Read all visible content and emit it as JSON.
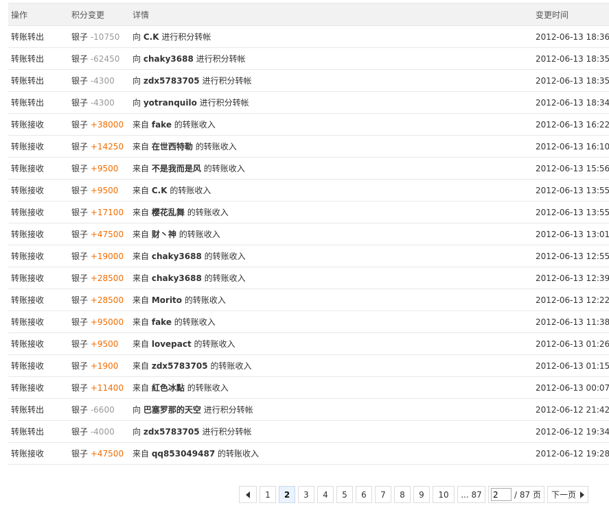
{
  "headers": {
    "action": "操作",
    "change": "积分变更",
    "detail": "详情",
    "time": "变更时间"
  },
  "rows": [
    {
      "action": "转账转出",
      "cur": "银子",
      "amount": "-10750",
      "sign": "neg",
      "pre": "向",
      "user": "C.K",
      "post": "进行积分转帐",
      "time": "2012-06-13 18:36"
    },
    {
      "action": "转账转出",
      "cur": "银子",
      "amount": "-62450",
      "sign": "neg",
      "pre": "向",
      "user": "chaky3688",
      "post": "进行积分转帐",
      "time": "2012-06-13 18:35"
    },
    {
      "action": "转账转出",
      "cur": "银子",
      "amount": "-4300",
      "sign": "neg",
      "pre": "向",
      "user": "zdx5783705",
      "post": "进行积分转帐",
      "time": "2012-06-13 18:35"
    },
    {
      "action": "转账转出",
      "cur": "银子",
      "amount": "-4300",
      "sign": "neg",
      "pre": "向",
      "user": "yotranquilo",
      "post": "进行积分转帐",
      "time": "2012-06-13 18:34"
    },
    {
      "action": "转账接收",
      "cur": "银子",
      "amount": "+38000",
      "sign": "pos",
      "pre": "来自",
      "user": "fake",
      "post": "的转账收入",
      "time": "2012-06-13 16:22"
    },
    {
      "action": "转账接收",
      "cur": "银子",
      "amount": "+14250",
      "sign": "pos",
      "pre": "来自",
      "user": "在世西特勒",
      "post": "的转账收入",
      "time": "2012-06-13 16:10"
    },
    {
      "action": "转账接收",
      "cur": "银子",
      "amount": "+9500",
      "sign": "pos",
      "pre": "来自",
      "user": "不是我而是风",
      "post": "的转账收入",
      "time": "2012-06-13 15:56"
    },
    {
      "action": "转账接收",
      "cur": "银子",
      "amount": "+9500",
      "sign": "pos",
      "pre": "来自",
      "user": "C.K",
      "post": "的转账收入",
      "time": "2012-06-13 13:55"
    },
    {
      "action": "转账接收",
      "cur": "银子",
      "amount": "+17100",
      "sign": "pos",
      "pre": "来自",
      "user": "樱花乱舞",
      "post": "的转账收入",
      "time": "2012-06-13 13:55"
    },
    {
      "action": "转账接收",
      "cur": "银子",
      "amount": "+47500",
      "sign": "pos",
      "pre": "来自",
      "user": "财丶神",
      "post": "的转账收入",
      "time": "2012-06-13 13:01"
    },
    {
      "action": "转账接收",
      "cur": "银子",
      "amount": "+19000",
      "sign": "pos",
      "pre": "来自",
      "user": "chaky3688",
      "post": "的转账收入",
      "time": "2012-06-13 12:55"
    },
    {
      "action": "转账接收",
      "cur": "银子",
      "amount": "+28500",
      "sign": "pos",
      "pre": "来自",
      "user": "chaky3688",
      "post": "的转账收入",
      "time": "2012-06-13 12:39"
    },
    {
      "action": "转账接收",
      "cur": "银子",
      "amount": "+28500",
      "sign": "pos",
      "pre": "来自",
      "user": "Morito",
      "post": "的转账收入",
      "time": "2012-06-13 12:22"
    },
    {
      "action": "转账接收",
      "cur": "银子",
      "amount": "+95000",
      "sign": "pos",
      "pre": "来自",
      "user": "fake",
      "post": "的转账收入",
      "time": "2012-06-13 11:38"
    },
    {
      "action": "转账接收",
      "cur": "银子",
      "amount": "+9500",
      "sign": "pos",
      "pre": "来自",
      "user": "lovepact",
      "post": "的转账收入",
      "time": "2012-06-13 01:26"
    },
    {
      "action": "转账接收",
      "cur": "银子",
      "amount": "+1900",
      "sign": "pos",
      "pre": "来自",
      "user": "zdx5783705",
      "post": "的转账收入",
      "time": "2012-06-13 01:15"
    },
    {
      "action": "转账接收",
      "cur": "银子",
      "amount": "+11400",
      "sign": "pos",
      "pre": "来自",
      "user": "紅色冰點",
      "post": "的转账收入",
      "time": "2012-06-13 00:07"
    },
    {
      "action": "转账转出",
      "cur": "银子",
      "amount": "-6600",
      "sign": "neg",
      "pre": "向",
      "user": "巴塞罗那的天空",
      "post": "进行积分转帐",
      "time": "2012-06-12 21:42"
    },
    {
      "action": "转账转出",
      "cur": "银子",
      "amount": "-4000",
      "sign": "neg",
      "pre": "向",
      "user": "zdx5783705",
      "post": "进行积分转帐",
      "time": "2012-06-12 19:34"
    },
    {
      "action": "转账接收",
      "cur": "银子",
      "amount": "+47500",
      "sign": "pos",
      "pre": "来自",
      "user": "qq853049487",
      "post": "的转账收入",
      "time": "2012-06-12 19:28"
    }
  ],
  "pager": {
    "pages": [
      "1",
      "2",
      "3",
      "4",
      "5",
      "6",
      "7",
      "8",
      "9",
      "10"
    ],
    "current": "2",
    "last_label": "... 87",
    "jump_value": "2",
    "total_label": "/ 87 页",
    "next_label": "下一页"
  },
  "colors": {
    "negative": "#999999",
    "positive": "#f26c00",
    "header_bg": "#f2f2f2"
  }
}
